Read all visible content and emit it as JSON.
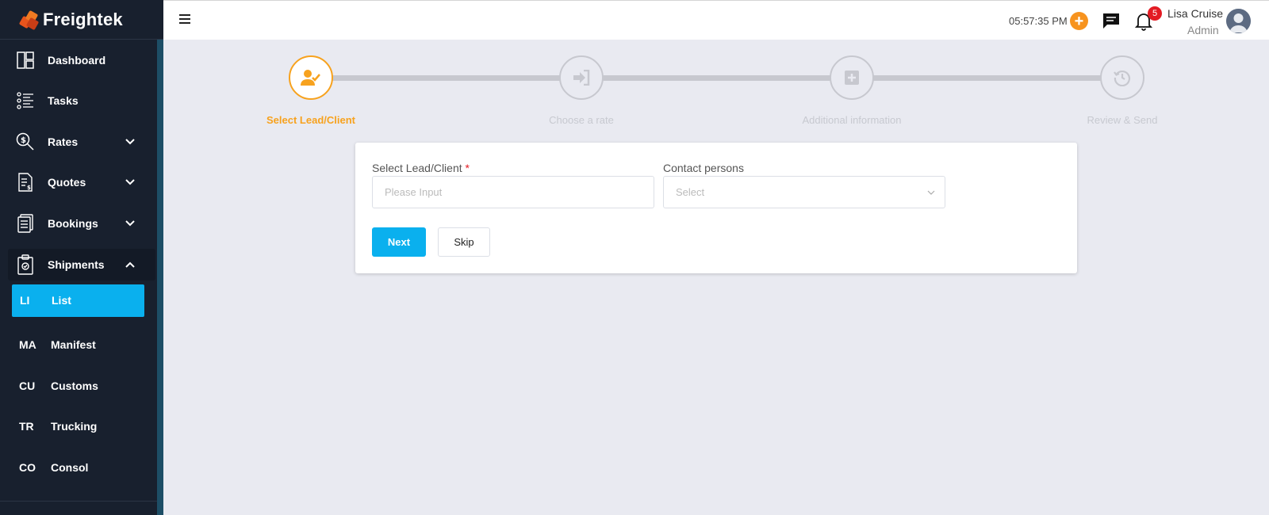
{
  "brand": {
    "name": "Freightek"
  },
  "sidebar": {
    "items": [
      {
        "label": "Dashboard",
        "icon": "dashboard-icon"
      },
      {
        "label": "Tasks",
        "icon": "tasks-icon"
      },
      {
        "label": "Rates",
        "icon": "rates-icon",
        "expandable": true
      },
      {
        "label": "Quotes",
        "icon": "quotes-icon",
        "expandable": true
      },
      {
        "label": "Bookings",
        "icon": "bookings-icon",
        "expandable": true
      },
      {
        "label": "Shipments",
        "icon": "shipments-icon",
        "expandable": true,
        "expanded": true
      }
    ],
    "sub_items": [
      {
        "abbr": "LI",
        "label": "List",
        "active": true
      },
      {
        "abbr": "MA",
        "label": "Manifest"
      },
      {
        "abbr": "CU",
        "label": "Customs"
      },
      {
        "abbr": "TR",
        "label": "Trucking"
      },
      {
        "abbr": "CO",
        "label": "Consol"
      }
    ]
  },
  "header": {
    "time": "05:57:35 PM",
    "notification_count": "5",
    "user_name": "Lisa Cruise",
    "user_role": "Admin"
  },
  "stepper": {
    "steps": [
      {
        "label": "Select Lead/Client",
        "active": true,
        "icon": "user-check-icon"
      },
      {
        "label": "Choose a rate",
        "icon": "sign-in-icon"
      },
      {
        "label": "Additional information",
        "icon": "plus-square-icon"
      },
      {
        "label": "Review & Send",
        "icon": "history-icon"
      }
    ]
  },
  "form": {
    "lead_label": "Select Lead/Client",
    "required_mark": "*",
    "lead_placeholder": "Please Input",
    "contact_label": "Contact persons",
    "contact_placeholder": "Select",
    "next_label": "Next",
    "skip_label": "Skip"
  },
  "colors": {
    "sidebar_bg": "#18202e",
    "accent_blue": "#0ab0ee",
    "accent_orange": "#f7a21e",
    "page_bg": "#e9eaf1",
    "badge_red": "#e31b23"
  }
}
